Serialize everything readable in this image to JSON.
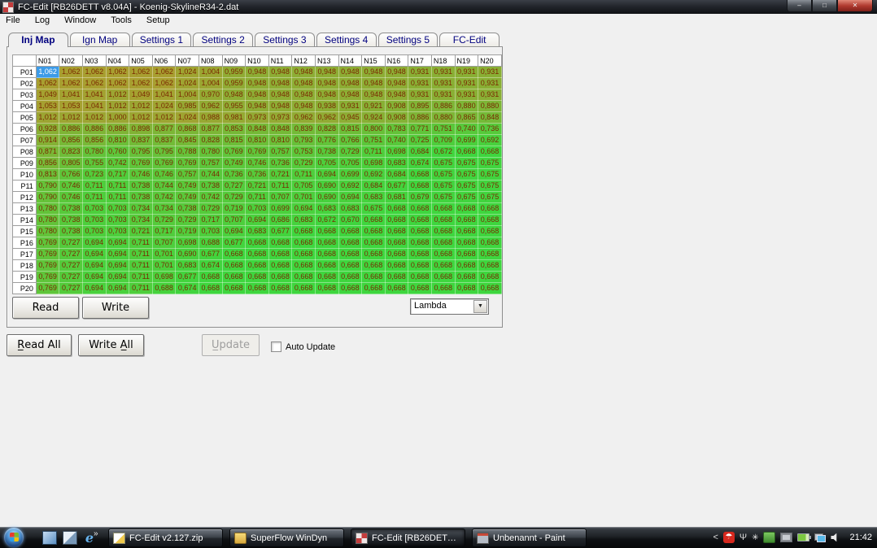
{
  "window": {
    "title": "FC-Edit [RB26DETT v8.04A] - Koenig-SkylineR34-2.dat",
    "controls": {
      "minimize": "–",
      "maximize": "□",
      "close": "✕"
    }
  },
  "menu": [
    "File",
    "Log",
    "Window",
    "Tools",
    "Setup"
  ],
  "tabs": [
    "Inj Map",
    "Ign Map",
    "Settings 1",
    "Settings 2",
    "Settings 3",
    "Settings 4",
    "Settings 5",
    "FC-Edit"
  ],
  "active_tab": "Inj Map",
  "map": {
    "col_headers": [
      "N01",
      "N02",
      "N03",
      "N04",
      "N05",
      "N06",
      "N07",
      "N08",
      "N09",
      "N10",
      "N11",
      "N12",
      "N13",
      "N14",
      "N15",
      "N16",
      "N17",
      "N18",
      "N19",
      "N20"
    ],
    "row_headers": [
      "P01",
      "P02",
      "P03",
      "P04",
      "P05",
      "P06",
      "P07",
      "P08",
      "P09",
      "P10",
      "P11",
      "P12",
      "P13",
      "P14",
      "P15",
      "P16",
      "P17",
      "P18",
      "P19",
      "P20"
    ],
    "decimal_separator": ",",
    "selected_cell": {
      "row": 0,
      "col": 0
    },
    "colors": {
      "low_color": "#3ED63E",
      "high_color": "#A89F30",
      "value_low": 0.668,
      "value_high": 1.062,
      "text": "#7A2800",
      "selected_bg": "#3C9BE8",
      "selected_text": "#FFFFFF"
    },
    "values": [
      [
        1.062,
        1.062,
        1.062,
        1.062,
        1.062,
        1.062,
        1.024,
        1.004,
        0.959,
        0.948,
        0.948,
        0.948,
        0.948,
        0.948,
        0.948,
        0.948,
        0.931,
        0.931,
        0.931,
        0.931
      ],
      [
        1.062,
        1.062,
        1.062,
        1.062,
        1.062,
        1.062,
        1.024,
        1.004,
        0.959,
        0.948,
        0.948,
        0.948,
        0.948,
        0.948,
        0.948,
        0.948,
        0.931,
        0.931,
        0.931,
        0.931
      ],
      [
        1.049,
        1.041,
        1.041,
        1.012,
        1.049,
        1.041,
        1.004,
        0.97,
        0.948,
        0.948,
        0.948,
        0.948,
        0.948,
        0.948,
        0.948,
        0.948,
        0.931,
        0.931,
        0.931,
        0.931
      ],
      [
        1.053,
        1.053,
        1.041,
        1.012,
        1.012,
        1.024,
        0.985,
        0.962,
        0.955,
        0.948,
        0.948,
        0.948,
        0.938,
        0.931,
        0.921,
        0.908,
        0.895,
        0.886,
        0.88,
        0.88
      ],
      [
        1.012,
        1.012,
        1.012,
        1.0,
        1.012,
        1.012,
        1.024,
        0.988,
        0.981,
        0.973,
        0.973,
        0.962,
        0.962,
        0.945,
        0.924,
        0.908,
        0.886,
        0.88,
        0.865,
        0.848
      ],
      [
        0.928,
        0.886,
        0.886,
        0.886,
        0.898,
        0.877,
        0.868,
        0.877,
        0.853,
        0.848,
        0.848,
        0.839,
        0.828,
        0.815,
        0.8,
        0.783,
        0.771,
        0.751,
        0.74,
        0.736
      ],
      [
        0.914,
        0.856,
        0.856,
        0.81,
        0.837,
        0.837,
        0.845,
        0.828,
        0.815,
        0.81,
        0.81,
        0.793,
        0.776,
        0.766,
        0.751,
        0.74,
        0.725,
        0.709,
        0.699,
        0.692
      ],
      [
        0.871,
        0.823,
        0.78,
        0.76,
        0.795,
        0.795,
        0.788,
        0.78,
        0.769,
        0.769,
        0.757,
        0.753,
        0.738,
        0.729,
        0.711,
        0.698,
        0.684,
        0.672,
        0.668,
        0.668
      ],
      [
        0.856,
        0.805,
        0.755,
        0.742,
        0.769,
        0.769,
        0.769,
        0.757,
        0.749,
        0.746,
        0.736,
        0.729,
        0.705,
        0.705,
        0.698,
        0.683,
        0.674,
        0.675,
        0.675,
        0.675
      ],
      [
        0.813,
        0.766,
        0.723,
        0.717,
        0.746,
        0.746,
        0.757,
        0.744,
        0.736,
        0.736,
        0.721,
        0.711,
        0.694,
        0.699,
        0.692,
        0.684,
        0.668,
        0.675,
        0.675,
        0.675
      ],
      [
        0.79,
        0.746,
        0.711,
        0.711,
        0.738,
        0.744,
        0.749,
        0.738,
        0.727,
        0.721,
        0.711,
        0.705,
        0.69,
        0.692,
        0.684,
        0.677,
        0.668,
        0.675,
        0.675,
        0.675
      ],
      [
        0.79,
        0.746,
        0.711,
        0.711,
        0.738,
        0.742,
        0.749,
        0.742,
        0.729,
        0.711,
        0.707,
        0.701,
        0.69,
        0.694,
        0.683,
        0.681,
        0.679,
        0.675,
        0.675,
        0.675
      ],
      [
        0.78,
        0.738,
        0.703,
        0.703,
        0.734,
        0.734,
        0.738,
        0.729,
        0.719,
        0.703,
        0.699,
        0.694,
        0.683,
        0.683,
        0.675,
        0.668,
        0.668,
        0.668,
        0.668,
        0.668
      ],
      [
        0.78,
        0.738,
        0.703,
        0.703,
        0.734,
        0.729,
        0.729,
        0.717,
        0.707,
        0.694,
        0.686,
        0.683,
        0.672,
        0.67,
        0.668,
        0.668,
        0.668,
        0.668,
        0.668,
        0.668
      ],
      [
        0.78,
        0.738,
        0.703,
        0.703,
        0.721,
        0.717,
        0.719,
        0.703,
        0.694,
        0.683,
        0.677,
        0.668,
        0.668,
        0.668,
        0.668,
        0.668,
        0.668,
        0.668,
        0.668,
        0.668
      ],
      [
        0.769,
        0.727,
        0.694,
        0.694,
        0.711,
        0.707,
        0.698,
        0.688,
        0.677,
        0.668,
        0.668,
        0.668,
        0.668,
        0.668,
        0.668,
        0.668,
        0.668,
        0.668,
        0.668,
        0.668
      ],
      [
        0.769,
        0.727,
        0.694,
        0.694,
        0.711,
        0.701,
        0.69,
        0.677,
        0.668,
        0.668,
        0.668,
        0.668,
        0.668,
        0.668,
        0.668,
        0.668,
        0.668,
        0.668,
        0.668,
        0.668
      ],
      [
        0.769,
        0.727,
        0.694,
        0.694,
        0.711,
        0.701,
        0.683,
        0.674,
        0.668,
        0.668,
        0.668,
        0.668,
        0.668,
        0.668,
        0.668,
        0.668,
        0.668,
        0.668,
        0.668,
        0.668
      ],
      [
        0.769,
        0.727,
        0.694,
        0.694,
        0.711,
        0.698,
        0.677,
        0.668,
        0.668,
        0.668,
        0.668,
        0.668,
        0.668,
        0.668,
        0.668,
        0.668,
        0.668,
        0.668,
        0.668,
        0.668
      ],
      [
        0.769,
        0.727,
        0.694,
        0.694,
        0.711,
        0.688,
        0.674,
        0.668,
        0.668,
        0.668,
        0.668,
        0.668,
        0.668,
        0.668,
        0.668,
        0.668,
        0.668,
        0.668,
        0.668,
        0.668
      ]
    ]
  },
  "panel": {
    "read_label": "Read",
    "write_label": "Write",
    "unit_value": "Lambda"
  },
  "bottom": {
    "read_all": "R̲ead All",
    "write_all": "Write A̲ll",
    "update": "U̲pdate",
    "auto_update": "Auto Update",
    "auto_update_checked": false
  },
  "taskbar": {
    "overflow": "»",
    "quick_launch": [
      {
        "name": "show-desktop",
        "glyph": ""
      },
      {
        "name": "switch-windows",
        "glyph": ""
      },
      {
        "name": "internet-explorer",
        "glyph": "e"
      }
    ],
    "tasks": [
      {
        "label": "FC-Edit v2.127.zip",
        "icon": "zip-file",
        "active": false
      },
      {
        "label": "SuperFlow WinDyn",
        "icon": "folder",
        "active": false
      },
      {
        "label": "FC-Edit [RB26DETT ...",
        "icon": "fc-edit",
        "active": true
      },
      {
        "label": "Unbenannt - Paint",
        "icon": "paint",
        "active": false
      }
    ],
    "tray": [
      {
        "name": "collapse-chevron",
        "glyph": "<"
      },
      {
        "name": "avira-antivirus",
        "glyph": "☂"
      },
      {
        "name": "wireless",
        "glyph": "Ψ"
      },
      {
        "name": "snowflake",
        "glyph": "✳"
      },
      {
        "name": "sync-green",
        "glyph": ""
      },
      {
        "name": "display",
        "glyph": ""
      },
      {
        "name": "battery",
        "glyph": ""
      },
      {
        "name": "network",
        "glyph": ""
      },
      {
        "name": "volume",
        "glyph": ""
      }
    ],
    "clock": "21:42"
  }
}
